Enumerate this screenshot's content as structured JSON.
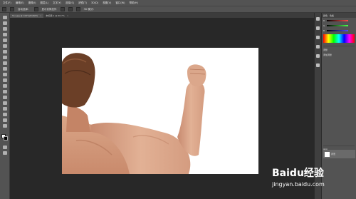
{
  "menu": [
    "文件(F)",
    "编辑(E)",
    "图像(I)",
    "图层(L)",
    "文字(Y)",
    "选择(S)",
    "滤镜(T)",
    "3D(D)",
    "视图(V)",
    "窗口(W)",
    "帮助(H)"
  ],
  "options": {
    "label1": "自动选择：",
    "label2": "显示变换控件",
    "mode": "3D 模式："
  },
  "tabs": [
    {
      "label": "Tuo.jpg @ 100%(RGB/8)",
      "close": "×"
    },
    {
      "label": "未标题-1 @ 66.7%",
      "close": "×"
    }
  ],
  "panels": {
    "tabs": [
      "颜色",
      "色板"
    ],
    "sliders": [
      {
        "label": "R",
        "color": "#ff4d4d"
      },
      {
        "label": "G",
        "color": "#4dff4d"
      },
      {
        "label": "B",
        "color": "#4d4dff"
      }
    ],
    "adjust_title": "调整",
    "adjust_label": "添加调整",
    "layers_title": "图层",
    "layer_name": "背景"
  },
  "watermark": {
    "brand": "Baidu经验",
    "url": "jingyan.baidu.com"
  }
}
